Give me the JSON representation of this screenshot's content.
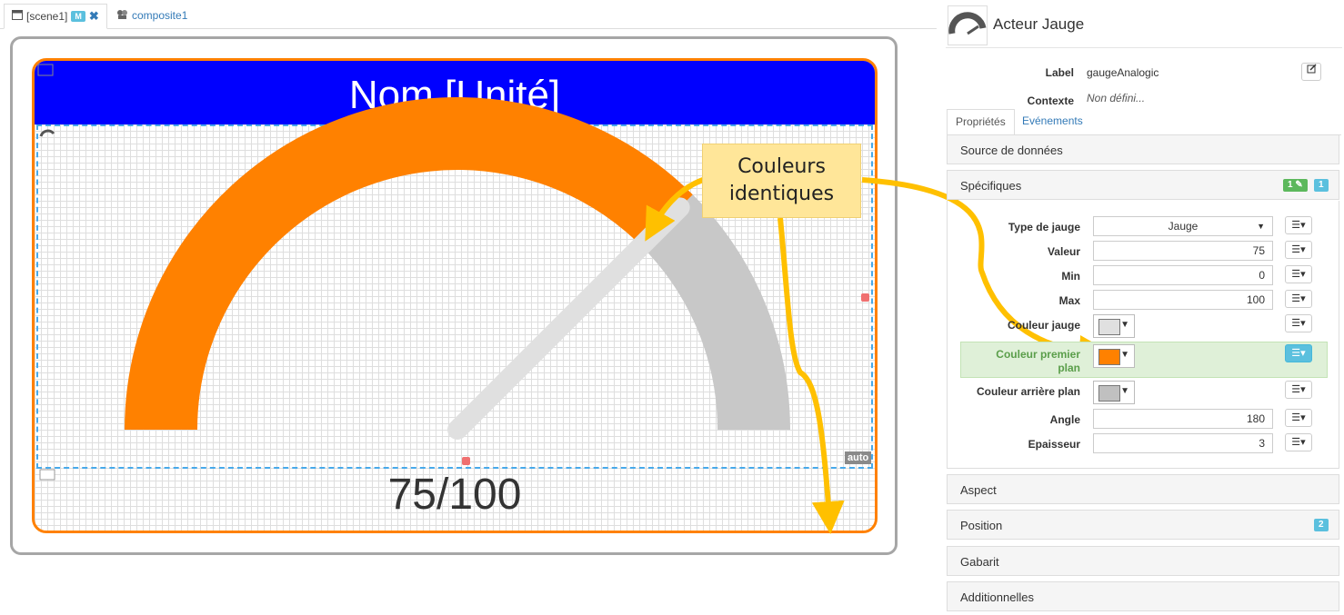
{
  "tabs": [
    {
      "label": "[scene1]",
      "badge": "M",
      "close": "✖"
    },
    {
      "label": "composite1"
    }
  ],
  "canvas": {
    "title": "Nom [Unité]",
    "value_text": "75/100",
    "auto_badge": "auto",
    "gauge": {
      "value": 75,
      "min": 0,
      "max": 100,
      "angle": 180,
      "foreground": "#ff8100",
      "background": "#c8c8c8",
      "needle": "#e0e0e0"
    },
    "colors": {
      "title_bg": "#0000ff",
      "frame": "#ff8100"
    }
  },
  "callout": {
    "line1": "Couleurs",
    "line2": "identiques"
  },
  "panel": {
    "title": "Acteur Jauge",
    "label_caption": "Label",
    "label_value": "gaugeAnalogic",
    "context_caption": "Contexte",
    "context_value": "Non défini...",
    "tabs": {
      "properties": "Propriétés",
      "events": "Evénements"
    },
    "sections": {
      "source": "Source de données",
      "specific": "Spécifiques",
      "specific_badge_green": "1",
      "specific_badge_blue": "1",
      "aspect": "Aspect",
      "position": "Position",
      "position_badge": "2",
      "template": "Gabarit",
      "additional": "Additionnelles"
    },
    "fields": {
      "type_label": "Type de jauge",
      "type_value": "Jauge",
      "value_label": "Valeur",
      "value_value": "75",
      "min_label": "Min",
      "min_value": "0",
      "max_label": "Max",
      "max_value": "100",
      "gauge_color_label": "Couleur jauge",
      "gauge_color": "#e0e0e0",
      "fg_color_label_1": "Couleur premier",
      "fg_color_label_2": "plan",
      "fg_color": "#ff8100",
      "bg_color_label": "Couleur arrière plan",
      "bg_color": "#c0c0c0",
      "angle_label": "Angle",
      "angle_value": "180",
      "thickness_label": "Epaisseur",
      "thickness_value": "3"
    }
  }
}
